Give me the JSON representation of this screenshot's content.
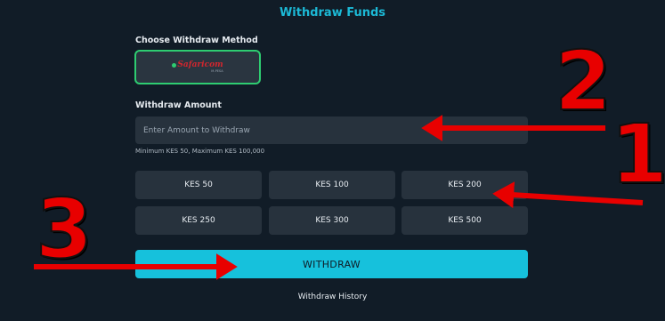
{
  "page": {
    "title": "Withdraw Funds"
  },
  "method": {
    "label": "Choose Withdraw Method",
    "selected": {
      "brand": "Safaricom",
      "tagline": "M-PESA"
    },
    "selected_border_color": "#2ecc71"
  },
  "amount": {
    "label": "Withdraw Amount",
    "value": "",
    "placeholder": "Enter Amount to Withdraw",
    "hint": "Minimum KES 50, Maximum KES 100,000"
  },
  "presets": [
    {
      "label": "KES 50"
    },
    {
      "label": "KES 100"
    },
    {
      "label": "KES 200"
    },
    {
      "label": "KES 250"
    },
    {
      "label": "KES 300"
    },
    {
      "label": "KES 500"
    }
  ],
  "submit": {
    "label": "WITHDRAW"
  },
  "footer": {
    "history_label": "Withdraw History"
  },
  "annotations": [
    {
      "number": "1",
      "points_to": "preset-amount-buttons"
    },
    {
      "number": "2",
      "points_to": "amount-input"
    },
    {
      "number": "3",
      "points_to": "withdraw-button"
    }
  ],
  "colors": {
    "background": "#111c27",
    "accent": "#16c1dc",
    "title": "#1cb9d6",
    "panel": "#27323d",
    "annotation": "#e80000"
  }
}
